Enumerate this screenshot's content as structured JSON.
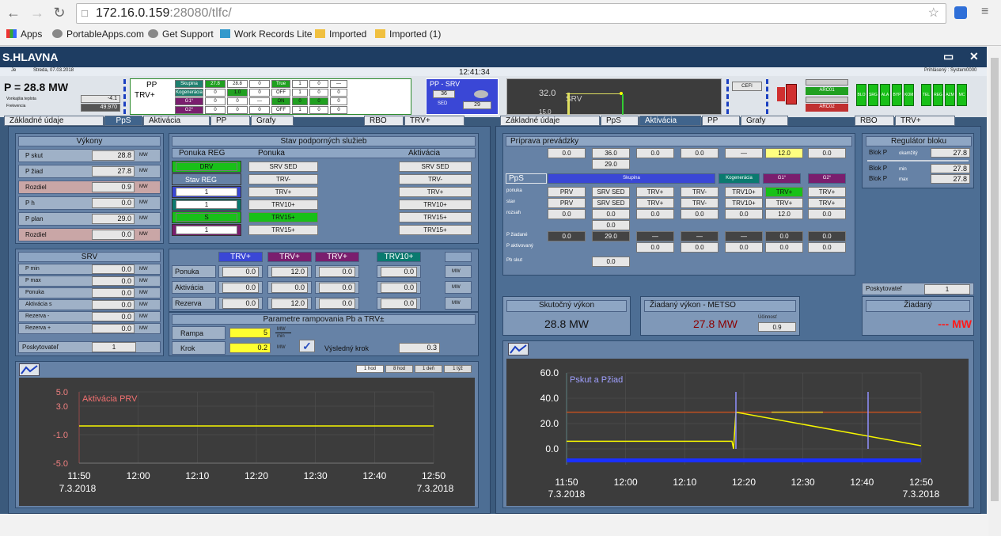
{
  "browser": {
    "url_host": "172.16.0.159",
    "url_path": ":28080/tlfc/",
    "bookmarks": [
      "Apps",
      "PortableApps.com",
      "Get Support",
      "Work Records Lite",
      "Imported",
      "Imported (1)"
    ]
  },
  "app": {
    "title": "S.HLAVNA",
    "clock": "12:41:34",
    "info_left": "Je",
    "info_date": "Streda, 07.03.2018",
    "info_right": "Prihlásený : System0000",
    "p_main": "P = 28.8 MW",
    "small_label1": "Vonkajšia teplota",
    "small_label2": "Frekvencia",
    "small_val1": "-4.1",
    "small_val2": "49.970",
    "pp_label": "PP",
    "trv_label": "TRV+",
    "header_table": {
      "cols": [
        "Skupina",
        "27.8",
        "28.8",
        "0",
        "True",
        "1",
        "0",
        "—"
      ],
      "rows": [
        [
          "Kogenerácia",
          "0",
          "1.0",
          "0",
          "OFF",
          "1",
          "0",
          "0"
        ],
        [
          "G1°",
          "0",
          "0",
          "—",
          "ON",
          "0",
          "0",
          "0"
        ],
        [
          "G2°",
          "0",
          "0",
          "0",
          "OFF",
          "1",
          "0",
          "0"
        ]
      ]
    },
    "pp_srv": {
      "title": "PP - SRV",
      "v1": "36",
      "sed": "SED",
      "v2": "29"
    },
    "top_chart": {
      "val": "32.0",
      "label": "SRV",
      "val2": "15.0"
    },
    "cefi": "CEFI",
    "arc_labels": [
      "ARC01",
      "ARC02"
    ],
    "green_labels": [
      "BLO",
      "SRG",
      "ALA",
      "BYP",
      "KOM",
      "TEL",
      "REG",
      "AZM",
      "MC"
    ]
  },
  "tabs_left": [
    "Základné údaje",
    "PpS",
    "Aktivácia",
    "PP",
    "Grafy",
    "RBO",
    "TRV+"
  ],
  "tabs_right": [
    "Základné údaje",
    "PpS",
    "Aktivácia",
    "PP",
    "Grafy",
    "RBO",
    "TRV+"
  ],
  "vykony": {
    "title": "Výkony",
    "rows": [
      {
        "label": "P skut",
        "value": "28.8",
        "unit": "MW"
      },
      {
        "label": "P žiad",
        "value": "27.8",
        "unit": "MW"
      },
      {
        "label": "Rozdiel",
        "value": "0.9",
        "unit": "MW"
      },
      {
        "label": "P h",
        "value": "0.0",
        "unit": "MW"
      },
      {
        "label": "P plan",
        "value": "29.0",
        "unit": "MW"
      },
      {
        "label": "Rozdiel",
        "value": "0.0",
        "unit": "MW"
      }
    ]
  },
  "stav": {
    "title": "Stav podporných služieb",
    "col1": "Ponuka REG",
    "col2": "Ponuka",
    "col3": "Aktivácia",
    "drv": "DRV",
    "stav_reg": "Stav REG",
    "vals": [
      "1",
      "1",
      "S",
      "1"
    ],
    "ponuka": [
      "SRV SED",
      "TRV-",
      "TRV+",
      "TRV10+",
      "TRV15+",
      "TRV15+"
    ],
    "aktivacia": [
      "SRV SED",
      "TRV-",
      "TRV+",
      "TRV10+",
      "TRV15+",
      "TRV15+"
    ]
  },
  "srv": {
    "title": "SRV",
    "rows": [
      {
        "label": "P min",
        "value": "0.0",
        "unit": "MW"
      },
      {
        "label": "P max",
        "value": "0.0",
        "unit": "MW"
      },
      {
        "label": "Ponuka",
        "value": "0.0",
        "unit": "MW"
      },
      {
        "label": "Aktivácia s",
        "value": "0.0",
        "unit": "MW"
      },
      {
        "label": "Rezerva -",
        "value": "0.0",
        "unit": "MW"
      },
      {
        "label": "Rezerva +",
        "value": "0.0",
        "unit": "MW"
      }
    ],
    "poskytovatel_label": "Poskytovateľ",
    "poskytovatel_value": "1"
  },
  "trv": {
    "cols": [
      "TRV+",
      "TRV+",
      "TRV+",
      "TRV10+"
    ],
    "rows": [
      {
        "label": "Ponuka",
        "values": [
          "0.0",
          "12.0",
          "0.0",
          "0.0"
        ]
      },
      {
        "label": "Aktivácia",
        "values": [
          "0.0",
          "0.0",
          "0.0",
          "0.0"
        ]
      },
      {
        "label": "Rezerva",
        "values": [
          "0.0",
          "12.0",
          "0.0",
          "0.0"
        ]
      }
    ],
    "unit": "MW"
  },
  "rampa": {
    "title": "Parametre rampovania Pb a TRV±",
    "rampa_label": "Rampa",
    "rampa_value": "5",
    "krok_label": "Krok",
    "krok_value": "0.2",
    "vysledny_label": "Výsledný krok",
    "vysledny_value": "0.3"
  },
  "left_chart": {
    "buttons": [
      "1 hod",
      "8 hod",
      "1 deň",
      "1 týž"
    ],
    "yticks": [
      "5.0",
      "3.0",
      "-1.0",
      "-5.0"
    ],
    "xticks": [
      "11:50",
      "12:00",
      "12:10",
      "12:20",
      "12:30",
      "12:40",
      "12:50"
    ],
    "date_left": "7.3.2018",
    "date_right": "7.3.2018",
    "series_label": "Aktivácia PRV"
  },
  "priprava": {
    "title": "Príprava prevádzky",
    "top_vals": [
      "0.0",
      "36.0",
      "0.0",
      "0.0",
      "—",
      "12.0",
      "0.0"
    ],
    "top_sub": "29.0",
    "pps_label": "PpS",
    "band_labels": [
      "Skupina",
      "Kogenerácia",
      "G1°",
      "G2°"
    ],
    "row_labels": [
      "ponuka",
      "stav",
      "rozsah",
      "P žiadané",
      "P aktivovaný",
      "Pb skut"
    ],
    "ponuka": [
      "PRV",
      "SRV SED",
      "TRV+",
      "TRV-",
      "TRV10+",
      "TRV+",
      "TRV+"
    ],
    "stav": [
      "PRV",
      "SRV SED",
      "TRV+",
      "TRV-",
      "TRV10+",
      "TRV+",
      "TRV+"
    ],
    "rozsah": [
      "0.0",
      "0.0",
      "0.0",
      "0.0",
      "0.0",
      "12.0",
      "0.0"
    ],
    "rozsah_sub": "0.0",
    "p_ziad": [
      "0.0",
      "29.0",
      "—",
      "—",
      "—",
      "0.0",
      "0.0"
    ],
    "p_akt": [
      "0.0",
      "0.0",
      "0.0",
      "0.0",
      "0.0"
    ],
    "pb_skut": "0.0"
  },
  "regulator": {
    "title": "Regulátor bloku",
    "rows": [
      {
        "label": "Blok P",
        "sub": "okamžitý",
        "value": "27.8"
      },
      {
        "label": "Blok P",
        "sub": "min",
        "value": "27.8"
      },
      {
        "label": "Blok P",
        "sub": "max",
        "value": "27.8"
      }
    ]
  },
  "poskytovatel_r": {
    "label": "Poskytovateľ",
    "value": "1"
  },
  "skutocny": {
    "title": "Skutočný výkon",
    "value": "28.8 MW"
  },
  "ziadany_metso": {
    "title": "Žiadaný výkon - METSO",
    "value": "27.8 MW",
    "sub_label": "Účinnosť",
    "sub_value": "0.9"
  },
  "ziadany": {
    "title": "Žiadaný",
    "value": "--- MW"
  },
  "right_chart": {
    "series_label": "Pskut a Pžiad",
    "yticks": [
      "60.0",
      "40.0",
      "20.0",
      "0.0"
    ],
    "xticks": [
      "11:50",
      "12:00",
      "12:10",
      "12:20",
      "12:30",
      "12:40",
      "12:50"
    ],
    "date_left": "7.3.2018",
    "date_right": "7.3.2018"
  },
  "colors": {
    "app_bg": "#3b5a7c",
    "chart_bg": "#3c3c3c",
    "yellow": "#f5f500",
    "red": "#d04040",
    "green": "#20c020",
    "blue": "#2030ff"
  }
}
